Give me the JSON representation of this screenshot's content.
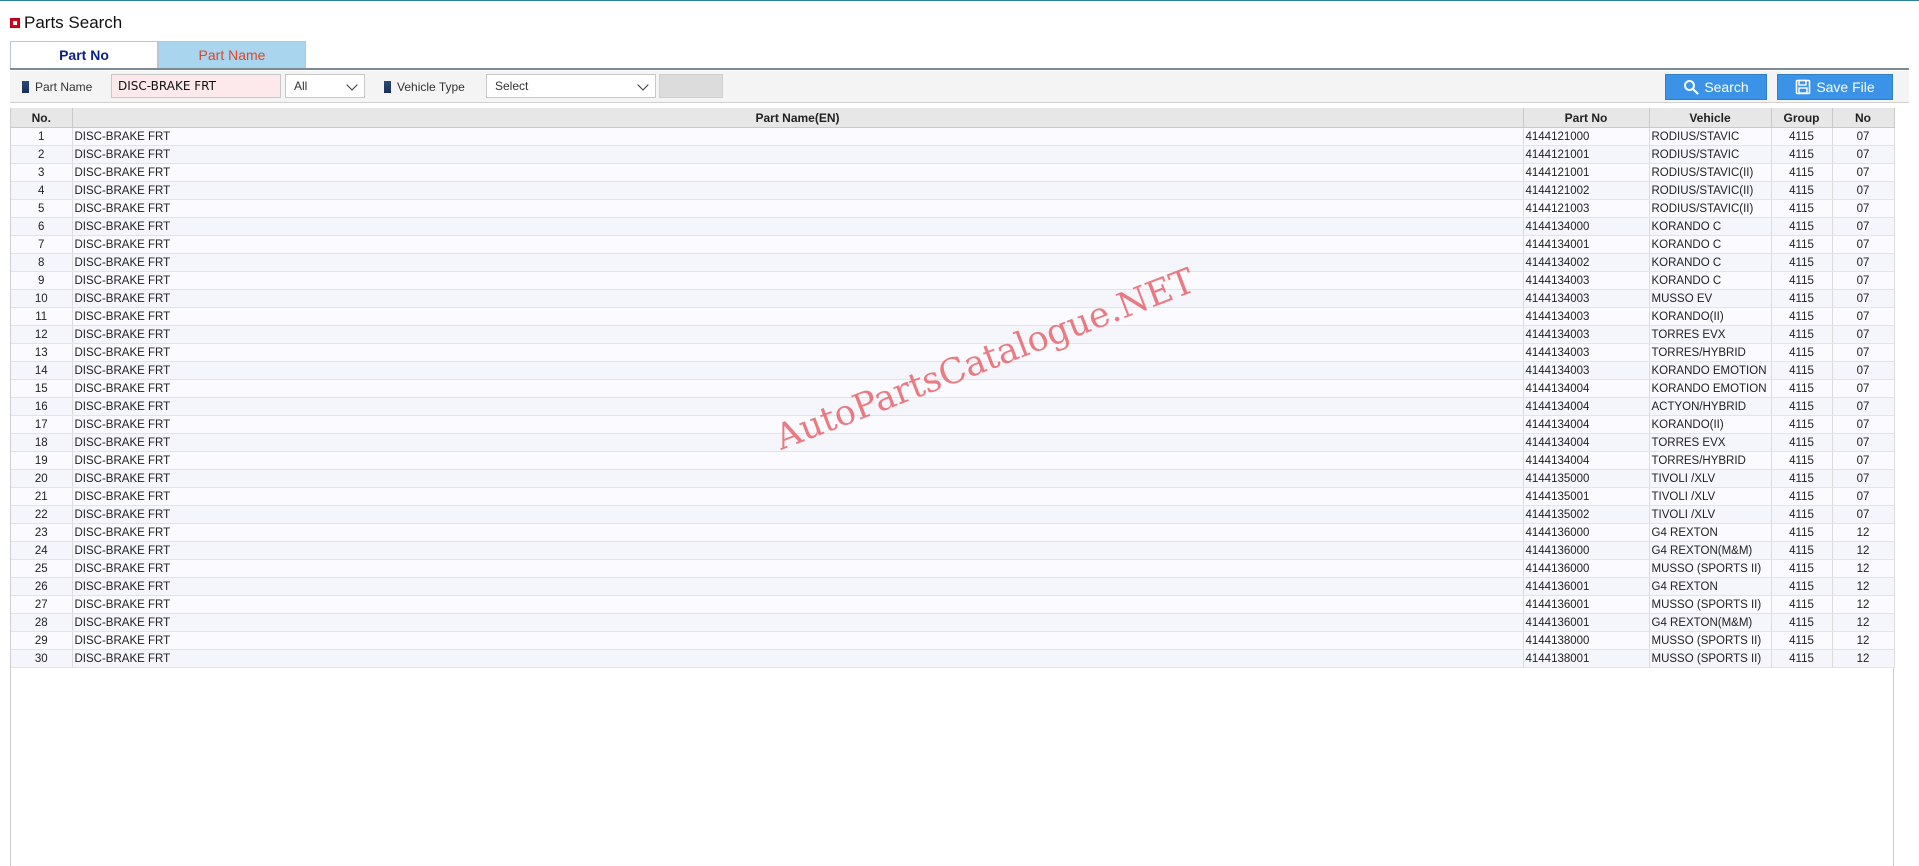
{
  "page": {
    "title": "Parts Search",
    "watermark": "AutoPartsCatalogue.NET"
  },
  "tabs": [
    {
      "label": "Part No",
      "active": false
    },
    {
      "label": "Part Name",
      "active": true
    }
  ],
  "toolbar": {
    "part_name_label": "Part Name",
    "part_name_value": "DISC-BRAKE FRT",
    "filter_select_value": "All",
    "vehicle_type_label": "Vehicle Type",
    "vehicle_type_value": "Select",
    "search_label": "Search",
    "save_label": "Save File"
  },
  "colors": {
    "accent": "#3a93e6",
    "active_tab_bg": "#a9d5ee",
    "active_tab_text": "#d64a2a",
    "inactive_tab_text": "#0b1f8a",
    "input_bg": "#fde9ec"
  },
  "icons": {
    "search": "magnifier-icon",
    "save": "floppy-disk-icon",
    "title": "red-square-icon"
  },
  "table": {
    "columns": [
      "No.",
      "Part Name(EN)",
      "Part No",
      "Vehicle",
      "Group",
      "No"
    ],
    "rows": [
      [
        "1",
        "DISC-BRAKE FRT",
        "4144121000",
        "RODIUS/STAVIC",
        "4115",
        "07"
      ],
      [
        "2",
        "DISC-BRAKE FRT",
        "4144121001",
        "RODIUS/STAVIC",
        "4115",
        "07"
      ],
      [
        "3",
        "DISC-BRAKE FRT",
        "4144121001",
        "RODIUS/STAVIC(II)",
        "4115",
        "07"
      ],
      [
        "4",
        "DISC-BRAKE FRT",
        "4144121002",
        "RODIUS/STAVIC(II)",
        "4115",
        "07"
      ],
      [
        "5",
        "DISC-BRAKE FRT",
        "4144121003",
        "RODIUS/STAVIC(II)",
        "4115",
        "07"
      ],
      [
        "6",
        "DISC-BRAKE FRT",
        "4144134000",
        "KORANDO C",
        "4115",
        "07"
      ],
      [
        "7",
        "DISC-BRAKE FRT",
        "4144134001",
        "KORANDO C",
        "4115",
        "07"
      ],
      [
        "8",
        "DISC-BRAKE FRT",
        "4144134002",
        "KORANDO C",
        "4115",
        "07"
      ],
      [
        "9",
        "DISC-BRAKE FRT",
        "4144134003",
        "KORANDO C",
        "4115",
        "07"
      ],
      [
        "10",
        "DISC-BRAKE FRT",
        "4144134003",
        "MUSSO EV",
        "4115",
        "07"
      ],
      [
        "11",
        "DISC-BRAKE FRT",
        "4144134003",
        "KORANDO(II)",
        "4115",
        "07"
      ],
      [
        "12",
        "DISC-BRAKE FRT",
        "4144134003",
        "TORRES EVX",
        "4115",
        "07"
      ],
      [
        "13",
        "DISC-BRAKE FRT",
        "4144134003",
        "TORRES/HYBRID",
        "4115",
        "07"
      ],
      [
        "14",
        "DISC-BRAKE FRT",
        "4144134003",
        "KORANDO EMOTION",
        "4115",
        "07"
      ],
      [
        "15",
        "DISC-BRAKE FRT",
        "4144134004",
        "KORANDO EMOTION",
        "4115",
        "07"
      ],
      [
        "16",
        "DISC-BRAKE FRT",
        "4144134004",
        "ACTYON/HYBRID",
        "4115",
        "07"
      ],
      [
        "17",
        "DISC-BRAKE FRT",
        "4144134004",
        "KORANDO(II)",
        "4115",
        "07"
      ],
      [
        "18",
        "DISC-BRAKE FRT",
        "4144134004",
        "TORRES EVX",
        "4115",
        "07"
      ],
      [
        "19",
        "DISC-BRAKE FRT",
        "4144134004",
        "TORRES/HYBRID",
        "4115",
        "07"
      ],
      [
        "20",
        "DISC-BRAKE FRT",
        "4144135000",
        "TIVOLI /XLV",
        "4115",
        "07"
      ],
      [
        "21",
        "DISC-BRAKE FRT",
        "4144135001",
        "TIVOLI /XLV",
        "4115",
        "07"
      ],
      [
        "22",
        "DISC-BRAKE FRT",
        "4144135002",
        "TIVOLI /XLV",
        "4115",
        "07"
      ],
      [
        "23",
        "DISC-BRAKE FRT",
        "4144136000",
        "G4 REXTON",
        "4115",
        "12"
      ],
      [
        "24",
        "DISC-BRAKE FRT",
        "4144136000",
        "G4 REXTON(M&M)",
        "4115",
        "12"
      ],
      [
        "25",
        "DISC-BRAKE FRT",
        "4144136000",
        "MUSSO (SPORTS II)",
        "4115",
        "12"
      ],
      [
        "26",
        "DISC-BRAKE FRT",
        "4144136001",
        "G4 REXTON",
        "4115",
        "12"
      ],
      [
        "27",
        "DISC-BRAKE FRT",
        "4144136001",
        "MUSSO (SPORTS II)",
        "4115",
        "12"
      ],
      [
        "28",
        "DISC-BRAKE FRT",
        "4144136001",
        "G4 REXTON(M&M)",
        "4115",
        "12"
      ],
      [
        "29",
        "DISC-BRAKE FRT",
        "4144138000",
        "MUSSO (SPORTS II)",
        "4115",
        "12"
      ],
      [
        "30",
        "DISC-BRAKE FRT",
        "4144138001",
        "MUSSO (SPORTS II)",
        "4115",
        "12"
      ]
    ]
  }
}
